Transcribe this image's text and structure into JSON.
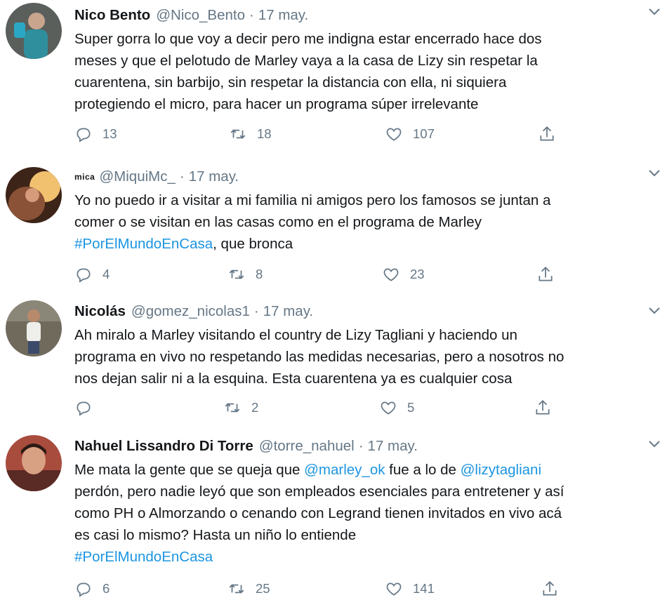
{
  "tweets": [
    {
      "display_name": "Nico Bento",
      "handle": "@Nico_Bento",
      "date": "17 may.",
      "text": "Super gorra lo que voy a decir pero me indigna estar encerrado hace dos\nmeses y que el pelotudo de Marley vaya a la casa de Lizy sin respetar la\ncuarentena, sin barbijo, sin respetar la distancia con ella, ni siquiera\nprotegiendo el micro, para hacer un programa súper irrelevante",
      "replies": "13",
      "retweets": "18",
      "likes": "107"
    },
    {
      "display_name": "mica",
      "handle": "@MiquiMc_",
      "date": "17 may.",
      "text_pre": "Yo no puedo ir a visitar a mi familia ni amigos pero los famosos se juntan a\ncomer o se visitan en las casas como en el programa de Marley\n",
      "hashtag": "#PorElMundoEnCasa",
      "text_post": ", que bronca",
      "replies": "4",
      "retweets": "8",
      "likes": "23"
    },
    {
      "display_name": "Nicolás",
      "handle": "@gomez_nicolas1",
      "date": "17 may.",
      "text": "Ah miralo a Marley visitando el country de Lizy Tagliani y haciendo un\nprograma en vivo no respetando las medidas necesarias, pero a nosotros no\nnos dejan salir ni a la esquina. Esta cuarentena ya es cualquier cosa",
      "replies": "",
      "retweets": "2",
      "likes": "5"
    },
    {
      "display_name": "Nahuel Lissandro Di Torre",
      "handle": "@torre_nahuel",
      "date": "17 may.",
      "text_1": "Me mata la gente que se queja que ",
      "mention_1": "@marley_ok",
      "text_2": " fue a lo de ",
      "mention_2": "@lizytagliani",
      "text_3": "\nperdón, pero nadie leyó que son empleados esenciales para entretener y así\ncomo PH o Almorzando o cenando con Legrand tienen invitados en vivo acá\nes casi lo mismo? Hasta un niño lo entiende\n",
      "hashtag": "#PorElMundoEnCasa",
      "replies": "6",
      "retweets": "25",
      "likes": "141"
    }
  ],
  "icons": {
    "reply": "reply-icon",
    "retweet": "retweet-icon",
    "like": "heart-icon",
    "share": "share-icon",
    "more": "chevron-down-icon"
  },
  "colors": {
    "text": "#14171a",
    "muted": "#657786",
    "link": "#1b95e0"
  }
}
